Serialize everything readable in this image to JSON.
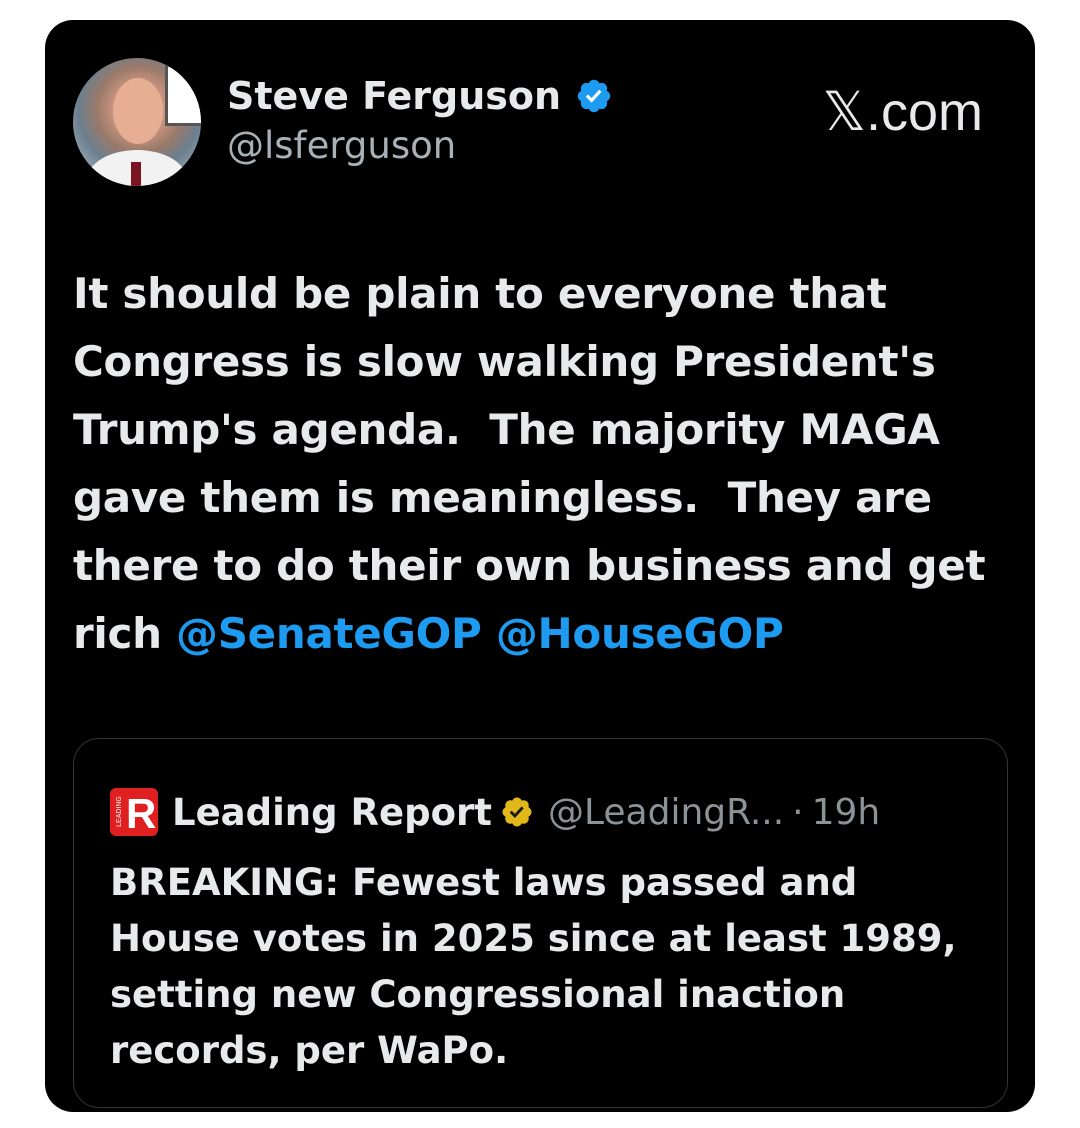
{
  "author": {
    "name": "Steve Ferguson",
    "handle": "@lsferguson",
    "verified_icon": "verified-badge-icon",
    "badge_color": "#1d9bf0"
  },
  "brand": {
    "logo_glyph": "𝕏",
    "logo_suffix": ".com"
  },
  "tweet": {
    "text": "It should be plain to everyone that Congress is slow walking President's Trump's agenda.  The majority MAGA gave them is meaningless.  They are there to do their own business and get rich ",
    "mentions": [
      "@SenateGOP",
      "@HouseGOP"
    ],
    "mention_color": "#1d9bf0"
  },
  "quote": {
    "logo_letter": "R",
    "logo_side_text": "LEADING",
    "logo_color": "#e02020",
    "name": "Leading Report",
    "verified_icon": "gold-verified-badge-icon",
    "badge_color": "#e2b719",
    "handle": "@LeadingR...",
    "separator": "·",
    "time": "19h",
    "text": "BREAKING: Fewest laws passed and House votes in 2025 since at least 1989, setting new Congressional inaction records, per WaPo."
  }
}
